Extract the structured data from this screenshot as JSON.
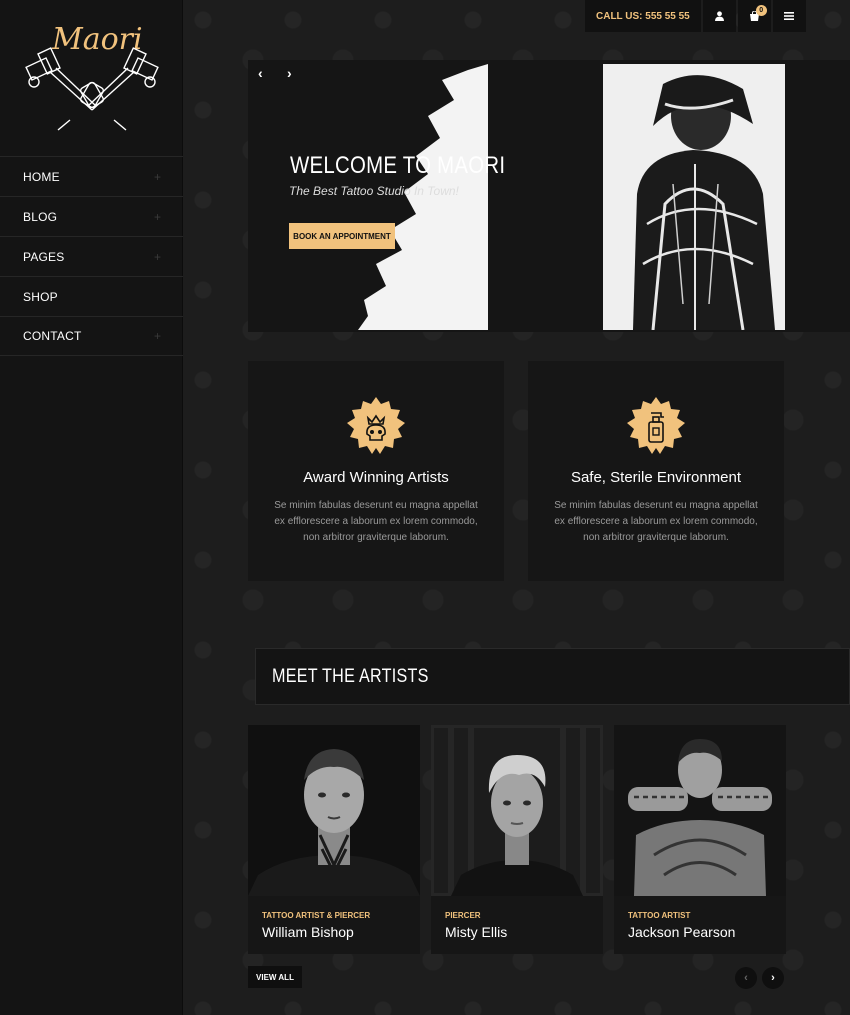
{
  "brand": {
    "logo_text": "Maori",
    "accent_color": "#f1c27d"
  },
  "topbar": {
    "call_label": "CALL US: 555 55 55",
    "user_icon": "user-icon",
    "cart_icon": "cart-icon",
    "cart_count": "0",
    "menu_icon": "hamburger-icon"
  },
  "nav": {
    "items": [
      {
        "label": "HOME",
        "has_submenu": true
      },
      {
        "label": "BLOG",
        "has_submenu": true
      },
      {
        "label": "PAGES",
        "has_submenu": true
      },
      {
        "label": "SHOP",
        "has_submenu": false
      },
      {
        "label": "CONTACT",
        "has_submenu": true
      }
    ]
  },
  "hero": {
    "prev": "‹",
    "next": "›",
    "title": "WELCOME TO MAORI",
    "subtitle": "The Best Tattoo Studio In Town!",
    "button": "BOOK AN APPOINTMENT"
  },
  "features": [
    {
      "icon": "skull-crown-icon",
      "title": "Award Winning Artists",
      "text": "Se minim fabulas deserunt eu magna appellat ex efflorescere a laborum ex lorem commodo, non arbitror graviterque laborum."
    },
    {
      "icon": "spray-bottle-icon",
      "title": "Safe, Sterile Environment",
      "text": "Se minim fabulas deserunt eu magna appellat ex efflorescere a laborum ex lorem commodo, non arbitror graviterque laborum."
    }
  ],
  "artists_section": {
    "title": "MEET THE ARTISTS",
    "view_all": "VIEW ALL",
    "prev": "‹",
    "next": "›"
  },
  "artists": [
    {
      "role": "TATTOO ARTIST & PIERCER",
      "name": "William Bishop"
    },
    {
      "role": "PIERCER",
      "name": "Misty Ellis"
    },
    {
      "role": "TATTOO ARTIST",
      "name": "Jackson Pearson"
    }
  ]
}
